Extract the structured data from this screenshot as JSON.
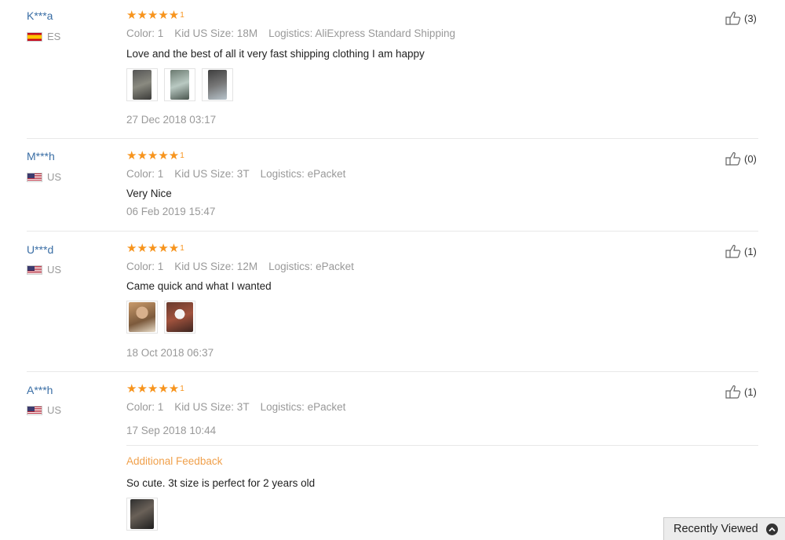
{
  "reviews": [
    {
      "user": "K***a",
      "country": "ES",
      "stars": "★★★★★",
      "star_count": "1",
      "color": "Color: 1",
      "size": "Kid US Size: 18M",
      "logistics": "Logistics: AliExpress Standard Shipping",
      "text": "Love and the best of all it very fast shipping clothing I am happy",
      "date": "27 Dec 2018 03:17",
      "helpful": "(3)",
      "photos": [
        "photo-1",
        "photo-2",
        "photo-3"
      ]
    },
    {
      "user": "M***h",
      "country": "US",
      "stars": "★★★★★",
      "star_count": "1",
      "color": "Color: 1",
      "size": "Kid US Size: 3T",
      "logistics": "Logistics: ePacket",
      "text": "Very Nice",
      "date": "06 Feb 2019 15:47",
      "helpful": "(0)",
      "photos": []
    },
    {
      "user": "U***d",
      "country": "US",
      "stars": "★★★★★",
      "star_count": "1",
      "color": "Color: 1",
      "size": "Kid US Size: 12M",
      "logistics": "Logistics: ePacket",
      "text": "Came quick and what I wanted",
      "date": "18 Oct 2018 06:37",
      "helpful": "(1)",
      "photos": [
        "photo-1",
        "photo-2"
      ]
    },
    {
      "user": "A***h",
      "country": "US",
      "stars": "★★★★★",
      "star_count": "1",
      "color": "Color: 1",
      "size": "Kid US Size: 3T",
      "logistics": "Logistics: ePacket",
      "date": "17 Sep 2018 10:44",
      "helpful": "(1)",
      "additional_label": "Additional Feedback",
      "additional_text": "So cute. 3t size is perfect for 2 years old",
      "photos": [
        "photo-1"
      ]
    }
  ],
  "recently_viewed": "Recently Viewed",
  "colors": {
    "star": "#f7941d",
    "user_link": "#3a6ea5",
    "additional": "#f0a04b"
  }
}
